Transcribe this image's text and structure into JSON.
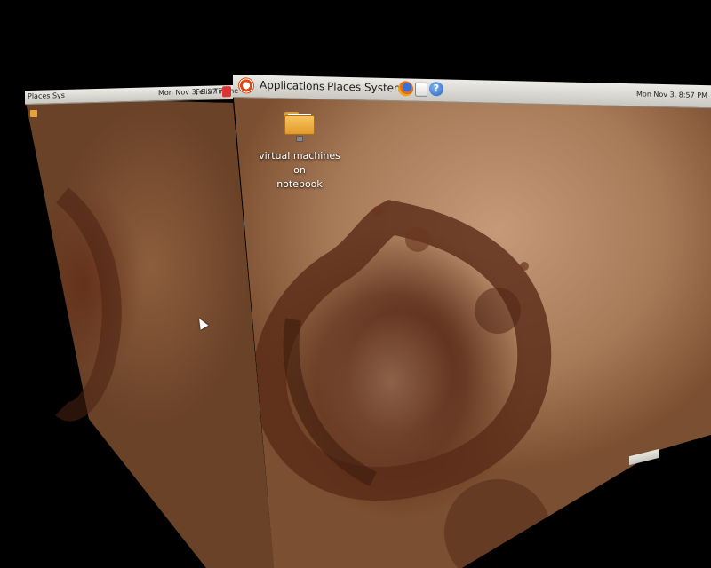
{
  "screen": {
    "background_color": "#000000"
  },
  "front_panel": {
    "menus": [
      {
        "label": "Applications"
      },
      {
        "label": "Places"
      },
      {
        "label": "System"
      }
    ],
    "launchers": [
      "firefox-icon",
      "mail-icon",
      "help-icon"
    ],
    "tray_clock": "Mon Nov 3, 8:57 PM",
    "panel_color": "#dcdad3"
  },
  "left_panel": {
    "apps_label": "Places Sys",
    "clock": "Mon Nov 3, 8:57 PM",
    "user": "Felix Timme"
  },
  "desktop": {
    "icon_label_line1": "virtual machines on",
    "icon_label_line2": "notebook",
    "wallpaper_colors": [
      "#c59a79",
      "#5d2e1a",
      "#7b4f31"
    ]
  }
}
